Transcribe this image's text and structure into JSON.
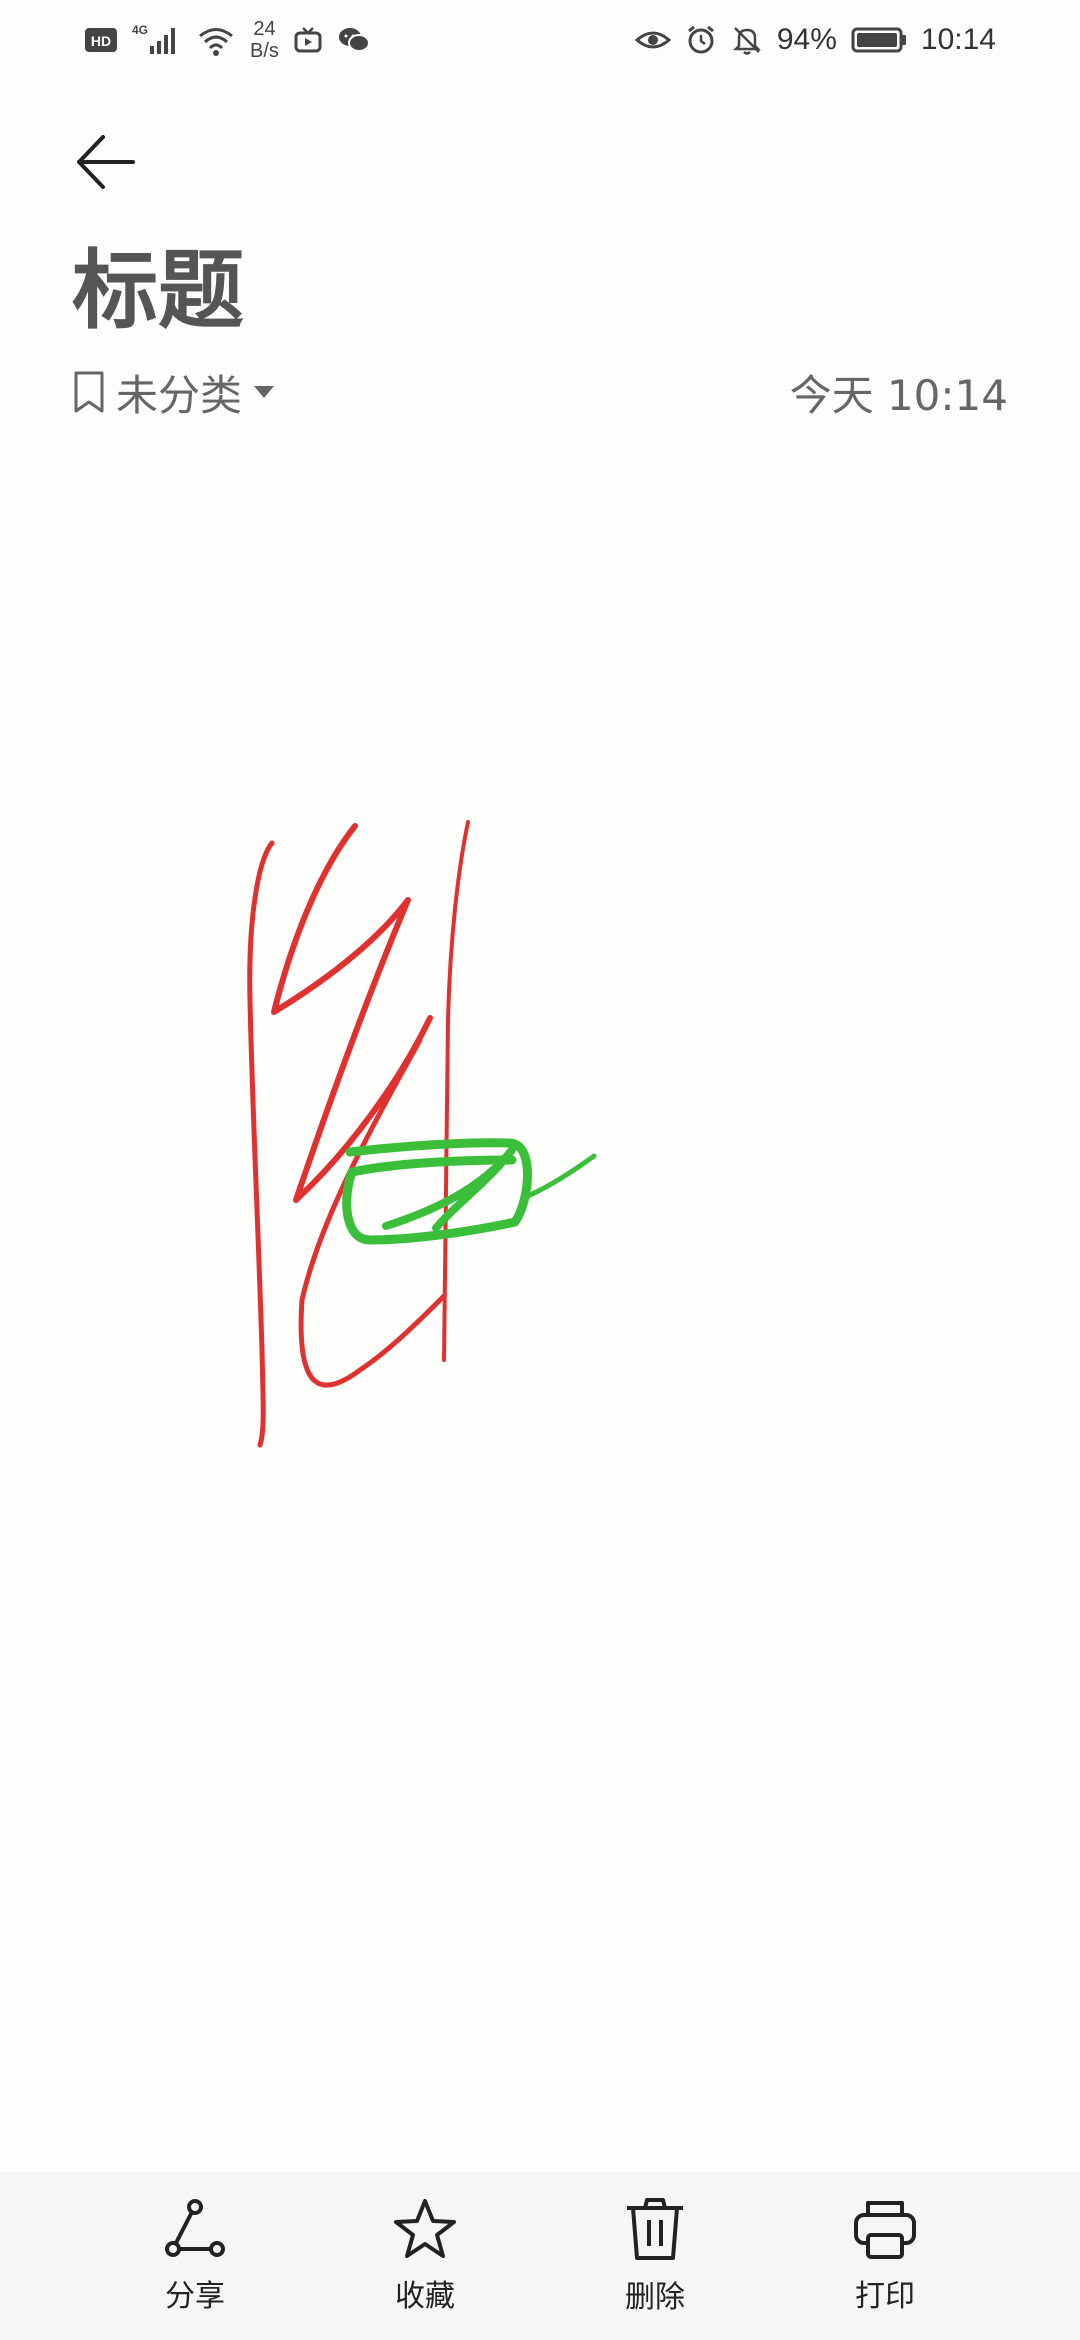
{
  "status_bar": {
    "hd": "HD",
    "network": "4G",
    "speed_value": "24",
    "speed_unit": "B/s",
    "battery": "94%",
    "time": "10:14",
    "icons": [
      "hd-icon",
      "signal-icon",
      "wifi-icon",
      "tv-icon",
      "wechat-icon",
      "eye-icon",
      "alarm-icon",
      "mute-icon",
      "battery-icon"
    ]
  },
  "header": {
    "back": "back-arrow-icon",
    "title": "标题",
    "category": "未分类",
    "date": "今天 10:14"
  },
  "drawing": {
    "strokes": [
      {
        "color": "#e03131"
      },
      {
        "color": "#3bbf3b"
      }
    ]
  },
  "toolbar": {
    "items": [
      {
        "label": "分享",
        "icon": "share-icon"
      },
      {
        "label": "收藏",
        "icon": "star-icon"
      },
      {
        "label": "删除",
        "icon": "trash-icon"
      },
      {
        "label": "打印",
        "icon": "printer-icon"
      }
    ]
  }
}
